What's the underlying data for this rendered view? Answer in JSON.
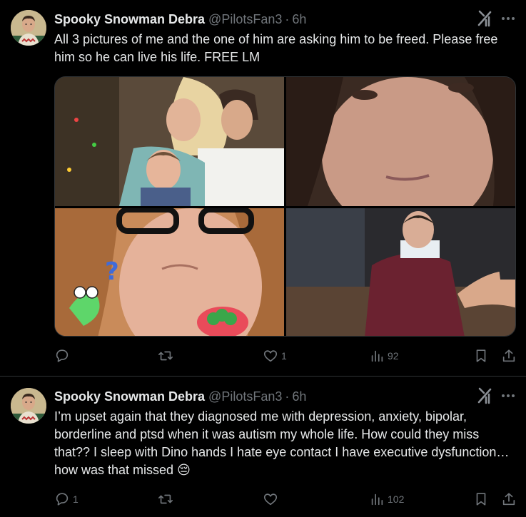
{
  "posts": [
    {
      "author_name": "Spooky Snowman Debra",
      "handle": "@PilotsFan3",
      "separator": "·",
      "time": "6h",
      "text": "All 3 pictures of me and the one of him are asking him to be freed. Please free him so he can live his life. FREE LM",
      "media": [
        {
          "description": "old family photo"
        },
        {
          "description": "selfie close-up"
        },
        {
          "description": "selfie with glasses and stickers"
        },
        {
          "description": "courtroom photo"
        }
      ],
      "stats": {
        "replies": "",
        "reposts": "",
        "likes": "1",
        "views": "92"
      }
    },
    {
      "author_name": "Spooky Snowman Debra",
      "handle": "@PilotsFan3",
      "separator": "·",
      "time": "6h",
      "text": "I’m upset again that they diagnosed me with depression, anxiety, bipolar, borderline and ptsd when it was autism my whole life. How could they miss that?? I sleep with Dino hands I hate eye contact I have executive dysfunction… how was that missed 😔",
      "stats": {
        "replies": "1",
        "reposts": "",
        "likes": "",
        "views": "102"
      }
    }
  ],
  "colors": {
    "background": "#000000",
    "text": "#e7e9ea",
    "muted": "#71767b",
    "divider": "#2f3336"
  },
  "icons": [
    "avatar",
    "grok-icon",
    "more-icon",
    "reply-icon",
    "repost-icon",
    "like-icon",
    "views-icon",
    "bookmark-icon",
    "share-icon"
  ]
}
